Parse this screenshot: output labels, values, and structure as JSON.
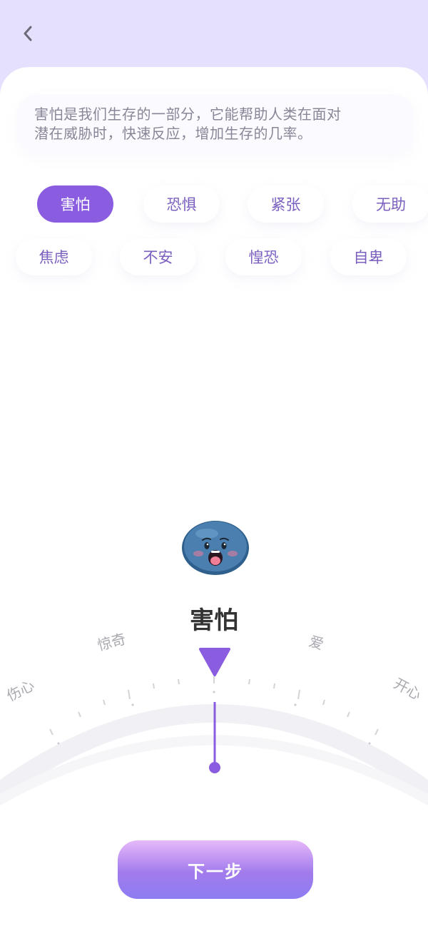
{
  "description": {
    "line1": "害怕是我们生存的一部分，它能帮助人类在面对",
    "line2": "潜在威胁时，快速反应，增加生存的几率。"
  },
  "chips": {
    "row1": [
      "害怕",
      "恐惧",
      "紧张",
      "无助"
    ],
    "row2": [
      "焦虑",
      "不安",
      "惶恐",
      "自卑"
    ],
    "selected": "害怕"
  },
  "selected_emotion": "害怕",
  "dial": {
    "labels": [
      "伤心",
      "惊奇",
      "爱",
      "开心"
    ]
  },
  "next_button": "下一步",
  "colors": {
    "accent": "#8a5ce0",
    "header_bg": "#e6e0ff",
    "chip_text": "#7a5fbf"
  },
  "icons": {
    "back": "chevron-left-icon",
    "mascot": "scared-blob-icon",
    "pointer": "triangle-down-icon"
  }
}
